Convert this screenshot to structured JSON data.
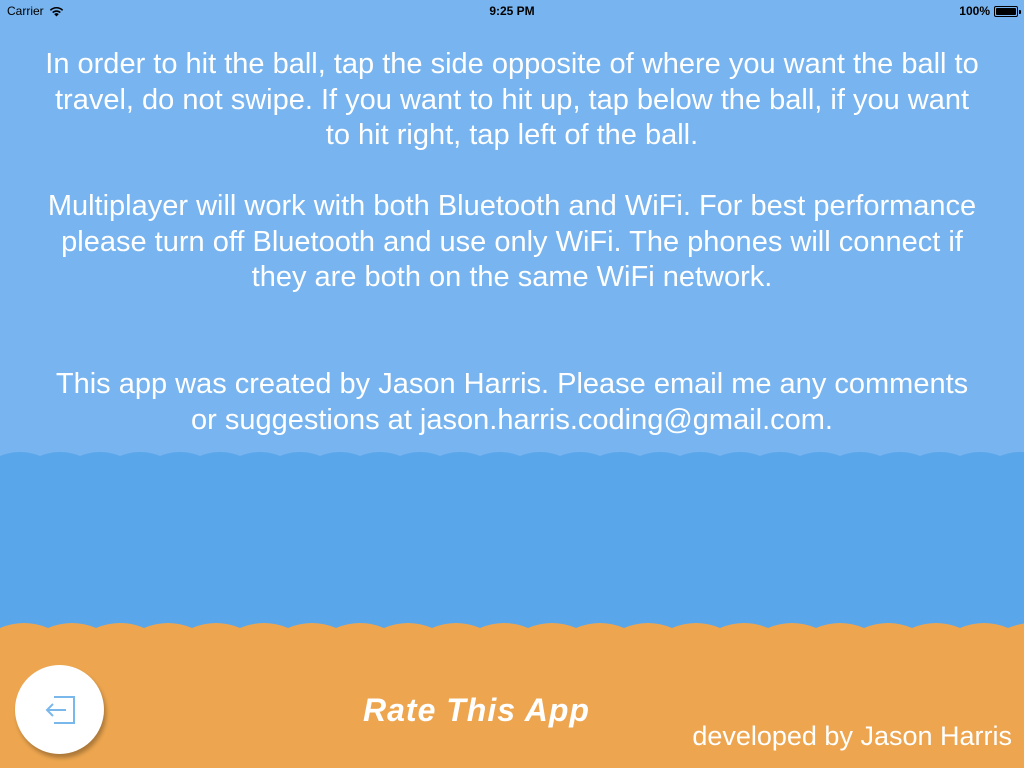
{
  "status_bar": {
    "carrier": "Carrier",
    "time": "9:25 PM",
    "battery_percent": "100%",
    "battery_level": 1.0,
    "icons": [
      "wifi-icon",
      "battery-icon"
    ]
  },
  "instructions": {
    "paragraph_1": "In order to hit the ball, tap the side opposite of where you want the ball to travel, do not swipe. If you want to hit up, tap below the ball, if you want to hit right, tap left of the ball.",
    "paragraph_2": "Multiplayer will work with both Bluetooth and WiFi. For best performance please turn off Bluetooth and use only WiFi. The phones will connect if they are both on the same WiFi network.",
    "paragraph_3": "This app was created by Jason Harris.  Please email me any comments or suggestions at jason.harris.coding@gmail.com."
  },
  "footer": {
    "back_icon": "back-arrow-icon",
    "rate_label": "Rate This App",
    "developer_credit": "developed by Jason Harris"
  },
  "colors": {
    "sky": "#78b4ef",
    "water": "#5aa6ea",
    "sand": "#eda64f",
    "text": "#ffffff",
    "back_icon": "#7ab8ec"
  }
}
